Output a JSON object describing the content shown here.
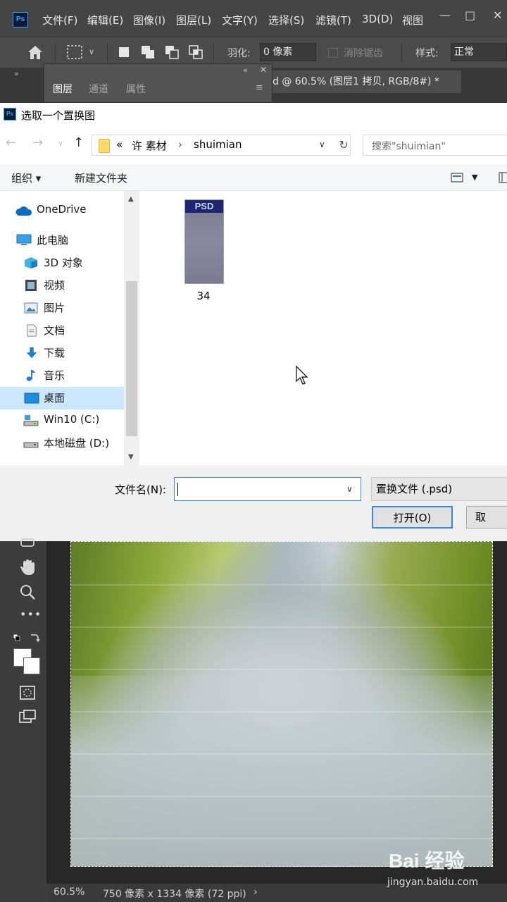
{
  "ps": {
    "logo": "Ps",
    "menu": [
      "文件(F)",
      "编辑(E)",
      "图像(I)",
      "图层(L)",
      "文字(Y)",
      "选择(S)",
      "滤镜(T)",
      "3D(D)",
      "视图"
    ],
    "options": {
      "feather_label": "羽化:",
      "feather_value": "0 像素",
      "antialias_label": "消除锯齿",
      "style_label": "样式:",
      "style_value": "正常"
    },
    "panel_tabs": [
      "图层",
      "通道",
      "属性"
    ],
    "doc_tab": "d @ 60.5% (图层1 拷贝, RGB/8#) *",
    "status": {
      "zoom": "60.5%",
      "size": "750 像素 x 1334 像素 (72 ppi)"
    }
  },
  "dialog": {
    "title": "选取一个置换图",
    "address": {
      "chevron": "«",
      "crumbs": [
        "许 素材",
        "shuimian"
      ]
    },
    "search_placeholder": "搜索\"shuimian\"",
    "commands": {
      "organize": "组织 ▾",
      "new_folder": "新建文件夹"
    },
    "nav_items": [
      {
        "label": "OneDrive",
        "icon": "cloud-icon"
      },
      {
        "label": "此电脑",
        "icon": "computer-icon"
      },
      {
        "label": "3D 对象",
        "icon": "cube-icon"
      },
      {
        "label": "视频",
        "icon": "video-icon"
      },
      {
        "label": "图片",
        "icon": "picture-icon"
      },
      {
        "label": "文档",
        "icon": "document-icon"
      },
      {
        "label": "下载",
        "icon": "download-icon"
      },
      {
        "label": "音乐",
        "icon": "music-icon"
      },
      {
        "label": "桌面",
        "icon": "desktop-icon"
      },
      {
        "label": "Win10 (C:)",
        "icon": "system-drive-icon"
      },
      {
        "label": "本地磁盘 (D:)",
        "icon": "drive-icon"
      }
    ],
    "selected_nav": "桌面",
    "files": [
      {
        "name": "34",
        "badge": "PSD"
      }
    ],
    "footer": {
      "filename_label": "文件名(N):",
      "filename_value": "",
      "filetype": "置换文件 (.psd)",
      "open_button": "打开(O)",
      "cancel_button": "取"
    }
  },
  "watermark": {
    "logo": "Bai 经验",
    "url": "jingyan.baidu.com"
  },
  "colors": {
    "ps_menubar": "#454545",
    "ps_options": "#4b4b4b",
    "dialog_bg": "#f0f0f0",
    "selected_nav": "#cce8ff",
    "accent_blue": "#3c87d6"
  }
}
